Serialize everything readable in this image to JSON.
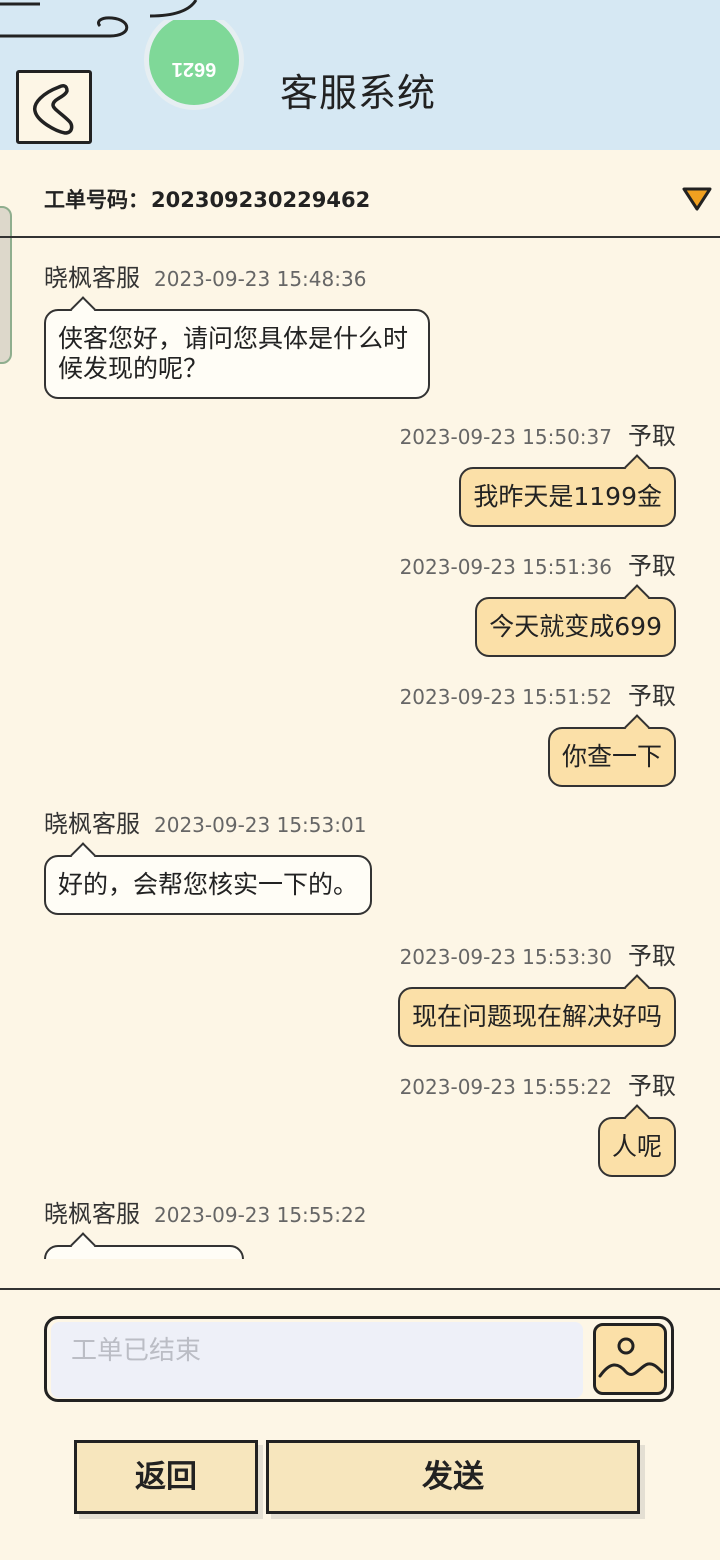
{
  "header": {
    "title": "客服系统",
    "avatar_text": "6621"
  },
  "ticket": {
    "label": "工单号码：",
    "number": "202309230229462"
  },
  "messages": [
    {
      "side": "left",
      "sender": "晓枫客服",
      "time": "2023-09-23 15:48:36",
      "text": "侠客您好，请问您具体是什么时候发现的呢？"
    },
    {
      "side": "right",
      "sender": "予取",
      "time": "2023-09-23 15:50:37",
      "text": "我昨天是1199金"
    },
    {
      "side": "right",
      "sender": "予取",
      "time": "2023-09-23 15:51:36",
      "text": "今天就变成699"
    },
    {
      "side": "right",
      "sender": "予取",
      "time": "2023-09-23 15:51:52",
      "text": "你查一下"
    },
    {
      "side": "left",
      "sender": "晓枫客服",
      "time": "2023-09-23 15:53:01",
      "text": "好的，会帮您核实一下的。"
    },
    {
      "side": "right",
      "sender": "予取",
      "time": "2023-09-23 15:53:30",
      "text": "现在问题现在解决好吗"
    },
    {
      "side": "right",
      "sender": "予取",
      "time": "2023-09-23 15:55:22",
      "text": "人呢"
    },
    {
      "side": "left",
      "sender": "晓枫客服",
      "time": "2023-09-23 15:55:22",
      "text": ""
    }
  ],
  "input": {
    "placeholder": "工单已结束"
  },
  "buttons": {
    "back": "返回",
    "send": "发送"
  },
  "colors": {
    "header_bg": "#d6e8f3",
    "page_bg": "#fdf6e6",
    "agent_bubble": "#fffdf6",
    "user_bubble": "#fbe0a8",
    "button_bg": "#f7e6bd"
  }
}
